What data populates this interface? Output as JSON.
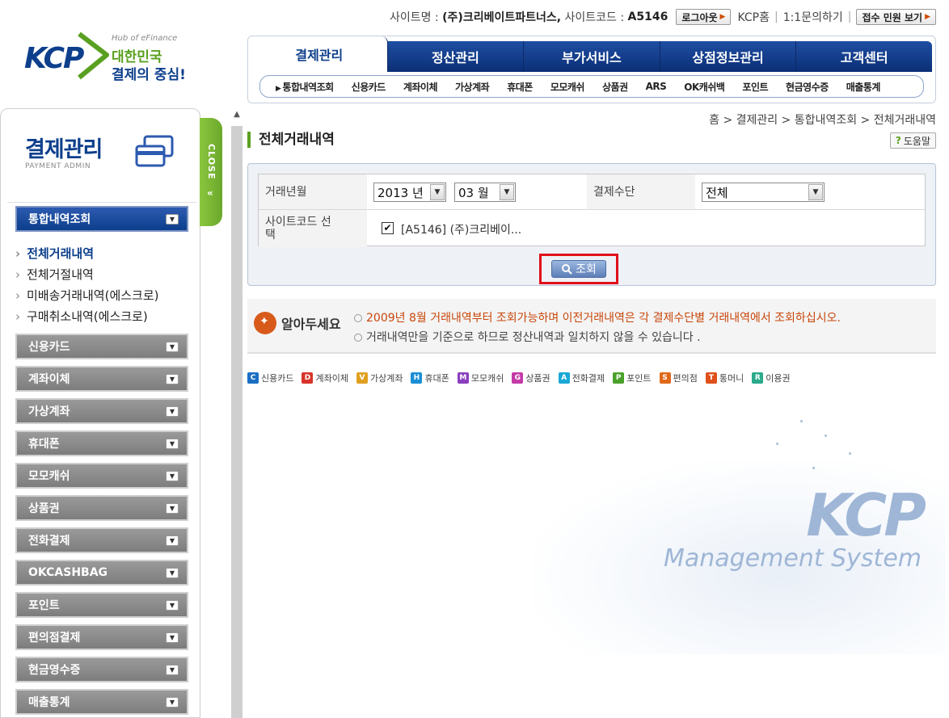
{
  "topinfo": {
    "site_name_label": "사이트명 :",
    "site_name": "(주)크리베이트파트너스,",
    "site_code_label": "사이트코드 :",
    "site_code": "A5146",
    "logout_label": "로그아웃",
    "kcp_home": "KCP홈",
    "inquiry": "1:1문의하기",
    "complaint_label": "접수 민원 보기"
  },
  "logo": {
    "brand": "KCP",
    "tagline_en": "Hub of eFinance",
    "line1": "대한민국",
    "line2": "결제의 중심!"
  },
  "nav": {
    "tabs": [
      "결제관리",
      "정산관리",
      "부가서비스",
      "상점정보관리",
      "고객센터"
    ],
    "sub": [
      "통합내역조회",
      "신용카드",
      "계좌이체",
      "가상계좌",
      "휴대폰",
      "모모캐쉬",
      "상품권",
      "ARS",
      "OK캐쉬백",
      "포인트",
      "현금영수증",
      "매출통계"
    ]
  },
  "sidebar": {
    "title": "결제관리",
    "subtitle": "PAYMENT ADMIN",
    "close_label": "CLOSE",
    "group_main": "통합내역조회",
    "items": [
      "전체거래내역",
      "전체거절내역",
      "미배송거래내역(에스크로)",
      "구매취소내역(에스크로)"
    ],
    "menus": [
      "신용카드",
      "계좌이체",
      "가상계좌",
      "휴대폰",
      "모모캐쉬",
      "상품권",
      "전화결제",
      "OKCASHBAG",
      "포인트",
      "편의점결제",
      "현금영수증",
      "매출통계"
    ]
  },
  "content": {
    "breadcrumb": "홈 > 결제관리 > 통합내역조회 > 전체거래내역",
    "title": "전체거래내역",
    "help_label": "도움말",
    "form": {
      "period_label": "거래년월",
      "year_value": "2013 년",
      "month_value": "03 월",
      "method_label": "결제수단",
      "method_value": "전체",
      "sitecode_label": "사이트코드 선택",
      "sitecode_value": "[A5146] (주)크리베이...",
      "sitecode_checked": true,
      "search_label": "조회"
    },
    "notice": {
      "title": "알아두세요",
      "line1": "2009년 8월 거래내역부터 조회가능하며 이전거래내역은 각 결제수단별 거래내역에서 조회하십시오.",
      "line2": "거래내역만을 기준으로 하므로 정산내역과 일치하지 않을 수 있습니다 ."
    },
    "legend": [
      {
        "code": "C",
        "label": "신용카드",
        "color": "#1a6fc4"
      },
      {
        "code": "D",
        "label": "계좌이체",
        "color": "#d8342a"
      },
      {
        "code": "V",
        "label": "가상계좌",
        "color": "#e0a020"
      },
      {
        "code": "H",
        "label": "휴대폰",
        "color": "#1a8fd6"
      },
      {
        "code": "M",
        "label": "모모캐쉬",
        "color": "#8a3fbf"
      },
      {
        "code": "G",
        "label": "상품권",
        "color": "#c43aa8"
      },
      {
        "code": "A",
        "label": "전화결제",
        "color": "#1aa8d6"
      },
      {
        "code": "P",
        "label": "포인트",
        "color": "#4aa12a"
      },
      {
        "code": "S",
        "label": "편의점",
        "color": "#e06a1a"
      },
      {
        "code": "T",
        "label": "통머니",
        "color": "#e0501a"
      },
      {
        "code": "R",
        "label": "이용권",
        "color": "#2aaa8a"
      }
    ],
    "watermark": {
      "brand": "KCP",
      "subtitle": "Management System"
    }
  }
}
